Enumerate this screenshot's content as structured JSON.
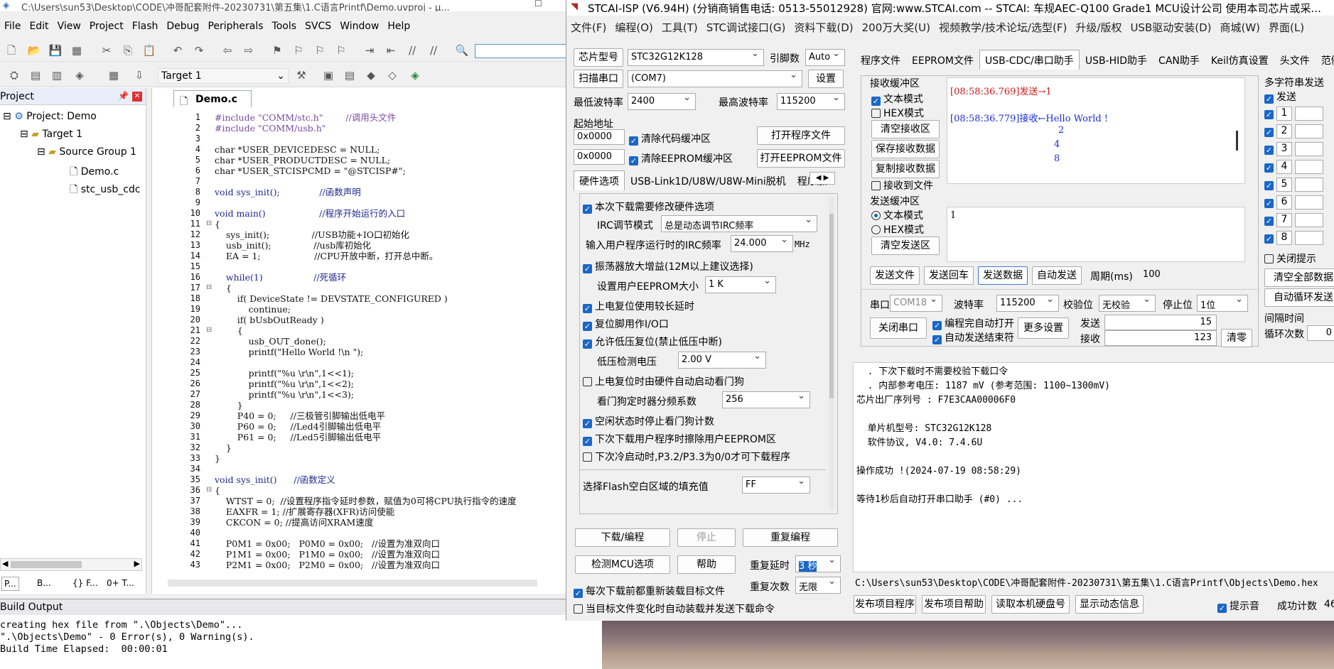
{
  "keil": {
    "title": "C:\\Users\\sun53\\Desktop\\CODE\\冲哥配套附件-20230731\\第五集\\1.C语言Printf\\Demo.uvproj - µ...",
    "menu": [
      "File",
      "Edit",
      "View",
      "Project",
      "Flash",
      "Debug",
      "Peripherals",
      "Tools",
      "SVCS",
      "Window",
      "Help"
    ],
    "target": "Target 1",
    "project_pane_title": "Project",
    "tree": {
      "project": "Project: Demo",
      "target": "Target 1",
      "group": "Source Group 1",
      "file1": "Demo.c",
      "file2": "stc_usb_cdc"
    },
    "bottom_tabs": [
      "P...",
      "B...",
      "{} F...",
      "0+ T..."
    ],
    "editor_tab": "Demo.c",
    "code_lines": [
      {
        "n": "1",
        "t": "#include \"COMM/stc.h\"        //调用头文件"
      },
      {
        "n": "2",
        "t": "#include \"COMM/usb.h\""
      },
      {
        "n": "3",
        "t": ""
      },
      {
        "n": "4",
        "t": "char *USER_DEVICEDESC = NULL;"
      },
      {
        "n": "5",
        "t": "char *USER_PRODUCTDESC = NULL;"
      },
      {
        "n": "6",
        "t": "char *USER_STCISPCMD = \"@STCISP#\";"
      },
      {
        "n": "7",
        "t": ""
      },
      {
        "n": "8",
        "t": "void sys_init();              //函数声明"
      },
      {
        "n": "9",
        "t": ""
      },
      {
        "n": "10",
        "t": "void main()                   //程序开始运行的入口"
      },
      {
        "n": "11",
        "t": "{"
      },
      {
        "n": "12",
        "t": "    sys_init();               //USB功能+IO口初始化"
      },
      {
        "n": "13",
        "t": "    usb_init();               //usb库初始化"
      },
      {
        "n": "14",
        "t": "    EA = 1;                   //CPU开放中断，打开总中断。"
      },
      {
        "n": "15",
        "t": ""
      },
      {
        "n": "16",
        "t": "    while(1)                  //死循环"
      },
      {
        "n": "17",
        "t": "    {"
      },
      {
        "n": "18",
        "t": "        if( DeviceState != DEVSTATE_CONFIGURED )"
      },
      {
        "n": "19",
        "t": "            continue;"
      },
      {
        "n": "20",
        "t": "        if( bUsbOutReady )"
      },
      {
        "n": "21",
        "t": "        {"
      },
      {
        "n": "22",
        "t": "            usb_OUT_done();"
      },
      {
        "n": "23",
        "t": "            printf(\"Hello World !\\n \");"
      },
      {
        "n": "24",
        "t": ""
      },
      {
        "n": "25",
        "t": "            printf(\"%u \\r\\n\",1<<1);"
      },
      {
        "n": "26",
        "t": "            printf(\"%u \\r\\n\",1<<2);"
      },
      {
        "n": "27",
        "t": "            printf(\"%u \\r\\n\",1<<3);"
      },
      {
        "n": "28",
        "t": "        }"
      },
      {
        "n": "29",
        "t": "        P40 = 0;     //三极管引脚输出低电平"
      },
      {
        "n": "30",
        "t": "        P60 = 0;     //Led4引脚输出低电平"
      },
      {
        "n": "31",
        "t": "        P61 = 0;     //Led5引脚输出低电平"
      },
      {
        "n": "32",
        "t": "    }"
      },
      {
        "n": "33",
        "t": "}"
      },
      {
        "n": "34",
        "t": ""
      },
      {
        "n": "35",
        "t": "void sys_init()      //函数定义"
      },
      {
        "n": "36",
        "t": "{"
      },
      {
        "n": "37",
        "t": "    WTST = 0;  //设置程序指令延时参数，赋值为0可将CPU执行指令的速度"
      },
      {
        "n": "38",
        "t": "    EAXFR = 1; //扩展寄存器(XFR)访问使能"
      },
      {
        "n": "39",
        "t": "    CKCON = 0; //提高访问XRAM速度"
      },
      {
        "n": "40",
        "t": ""
      },
      {
        "n": "41",
        "t": "    P0M1 = 0x00;   P0M0 = 0x00;   //设置为准双向口"
      },
      {
        "n": "42",
        "t": "    P1M1 = 0x00;   P1M0 = 0x00;   //设置为准双向口"
      },
      {
        "n": "43",
        "t": "    P2M1 = 0x00;   P2M0 = 0x00;   //设置为准双向口"
      }
    ],
    "build_title": "Build Output",
    "build_lines": [
      "creating hex file from \".\\Objects\\Demo\"...",
      "\".\\Objects\\Demo\" - 0 Error(s), 0 Warning(s).",
      "Build Time Elapsed:  00:00:01"
    ]
  },
  "stc": {
    "title": "STCAI-ISP (V6.94H) (分销商销售电话: 0513-55012928) 官网:www.STCAI.com  -- STCAI: 车规AEC-Q100 Grade1 MCU设计公司 使用本司芯片或采...",
    "menu": [
      "文件(F)",
      "编程(O)",
      "工具(T)",
      "STC调试接口(G)",
      "资料下载(D)",
      "200万大奖(U)",
      "视频教学/技术论坛/选型(F)",
      "升级/版权",
      "USB驱动安装(D)",
      "商城(W)",
      "界面(L)"
    ],
    "chip_label": "芯片型号",
    "chip_value": "STC32G12K128",
    "pin_label": "引脚数",
    "pin_value": "Auto",
    "scan_btn": "扫描串口",
    "port_value": "(COM7)",
    "settings_btn": "设置",
    "min_baud_label": "最低波特率",
    "min_baud": "2400",
    "max_baud_label": "最高波特率",
    "max_baud": "115200",
    "start_addr_label": "起始地址",
    "addr1": "0x0000",
    "addr2": "0x0000",
    "clear_code": "清除代码缓冲区",
    "clear_eeprom": "清除EEPROM缓冲区",
    "open_prog": "打开程序文件",
    "open_eeprom": "打开EEPROM文件",
    "left_tabs": [
      "硬件选项",
      "USB-Link1D/U8W/U8W-Mini脱机",
      "程序加"
    ],
    "hw_opts": {
      "modify_hw": "本次下载需要修改硬件选项",
      "irc_mode_label": "IRC调节模式",
      "irc_mode": "总是动态调节IRC频率",
      "irc_freq_label": "输入用户程序运行时的IRC频率",
      "irc_freq": "24.000",
      "mhz": "MHz",
      "osc_gain": "振荡器放大增益(12M以上建议选择)",
      "eeprom_size_label": "设置用户EEPROM大小",
      "eeprom_size": "1   K",
      "long_delay": "上电复位使用较长延时",
      "reset_io": "复位脚用作I/O口",
      "lvr": "允许低压复位(禁止低压中断)",
      "lvd_label": "低压检测电压",
      "lvd": "2.00 V",
      "wdt_auto": "上电复位时由硬件自动启动看门狗",
      "wdt_div_label": "看门狗定时器分频系数",
      "wdt_div": "256",
      "idle_wdt": "空闲状态时停止看门狗计数",
      "erase_eeprom": "下次下载用户程序时擦除用户EEPROM区",
      "cold_boot": "下次冷启动时,P3.2/P3.3为0/0才可下载程序",
      "fill_label": "选择Flash空白区域的填充值",
      "fill": "FF"
    },
    "download_btn": "下载/编程",
    "stop_btn": "停止",
    "reprog_btn": "重复编程",
    "detect_btn": "检测MCU选项",
    "help_btn": "帮助",
    "retry_delay_label": "重复延时",
    "retry_delay": "3 秒",
    "retry_count_label": "重复次数",
    "retry_count": "无限",
    "reload_cb": "每次下载前都重新装载目标文件",
    "autoload_cb": "当目标文件变化时自动装载并发送下载命令",
    "right_tabs": [
      "程序文件",
      "EEPROM文件",
      "USB-CDC/串口助手",
      "USB-HID助手",
      "CAN助手",
      "Keil仿真设置",
      "头文件",
      "范例程"
    ],
    "recv_title": "接收缓冲区",
    "text_mode": "文本模式",
    "hex_mode": "HEX模式",
    "clear_recv": "清空接收区",
    "save_recv": "保存接收数据",
    "copy_recv": "复制接收数据",
    "recv_to_file": "接收到文件",
    "recv_line1": "[08:58:36.769]发送→1",
    "recv_line2": "[08:58:36.779]接收←Hello World !",
    "recv_vals": [
      "2",
      "4",
      "8"
    ],
    "send_title": "发送缓冲区",
    "send_text_mode": "文本模式",
    "send_hex_mode": "HEX模式",
    "clear_send": "清空发送区",
    "send_content": "1",
    "send_file": "发送文件",
    "send_cr": "发送回车",
    "send_data": "发送数据",
    "auto_send": "自动发送",
    "period_label": "周期(ms)",
    "period": "100",
    "com_label": "串口",
    "com_value": "COM18",
    "baud_label": "波特率",
    "baud_value": "115200",
    "parity_label": "校验位",
    "parity_value": "无校验",
    "stop_label": "停止位",
    "stop_value": "1位",
    "close_port": "关闭串口",
    "auto_open": "编程完自动打开",
    "auto_send_end": "自动发送结束符",
    "more_settings": "更多设置",
    "send_count_label": "发送",
    "send_count": "15",
    "recv_count_label": "接收",
    "recv_count": "123",
    "clear_count": "清零",
    "multi_title": "多字符串发送",
    "multi_send": "发送",
    "multi_rows": [
      "1",
      "2",
      "3",
      "4",
      "5",
      "6",
      "7",
      "8"
    ],
    "close_hint": "关闭提示",
    "clear_all": "清空全部数据",
    "auto_cycle": "自动循环发送",
    "interval_label": "间隔时间",
    "loop_label": "循环次数",
    "loop_value": "0",
    "log_lines": [
      "  . 下次下载时不需要校验下载口令",
      "  . 内部参考电压: 1187 mV (参考范围: 1100~1300mV)",
      "芯片出厂序列号 : F7E3CAA00006F0",
      "",
      "  单片机型号: STC32G12K128",
      "  软件协议, V4.0: 7.4.6U",
      "",
      "操作成功 !(2024-07-19 08:58:29)",
      "",
      "等待1秒后自动打开串口助手 (#0) ..."
    ],
    "hex_path": "C:\\Users\\sun53\\Desktop\\CODE\\冲哥配套附件-20230731\\第五集\\1.C语言Printf\\Objects\\Demo.hex",
    "publish_prog": "发布项目程序",
    "publish_help": "发布项目帮助",
    "read_disk": "读取本机硬盘号",
    "show_dyn": "显示动态信息",
    "beep": "提示音",
    "success_count_label": "成功计数",
    "success_count": "46"
  }
}
